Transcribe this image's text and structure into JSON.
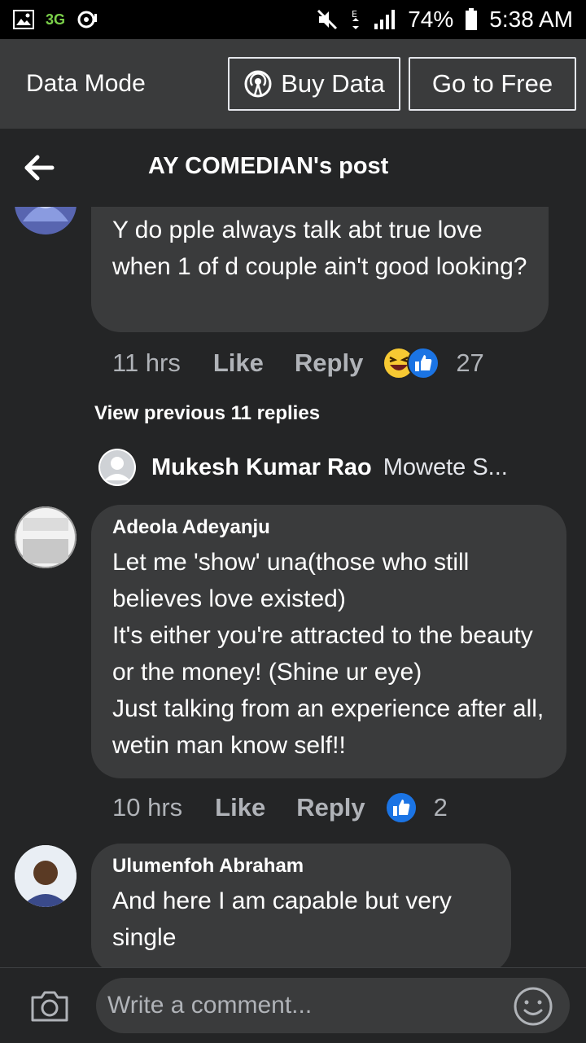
{
  "status_bar": {
    "network": "3G",
    "battery": "74%",
    "time": "5:38 AM"
  },
  "data_bar": {
    "label": "Data Mode",
    "buy_label": "Buy Data",
    "free_label": "Go to Free"
  },
  "header": {
    "title": "AY COMEDIAN's post"
  },
  "comments": [
    {
      "author": "",
      "text": "Y do pple always talk abt true love when 1 of d couple ain't good looking?",
      "time": "11 hrs",
      "like": "Like",
      "reply": "Reply",
      "reaction_count": "27"
    },
    {
      "author": "Adeola Adeyanju",
      "text": "Let me 'show' una(those who still believes love existed)\nIt's either you're attracted to the beauty or the money! (Shine ur eye)\nJust talking from an experience after all, wetin man know self!!",
      "time": "10 hrs",
      "like": "Like",
      "reply": "Reply",
      "reaction_count": "2"
    },
    {
      "author": "Ulumenfoh Abraham",
      "text": "And here I am capable but very single"
    }
  ],
  "view_previous": "View previous 11 replies",
  "reply_preview": {
    "name": "Mukesh Kumar Rao",
    "text": "Mowete S..."
  },
  "composer": {
    "placeholder": "Write a comment..."
  }
}
